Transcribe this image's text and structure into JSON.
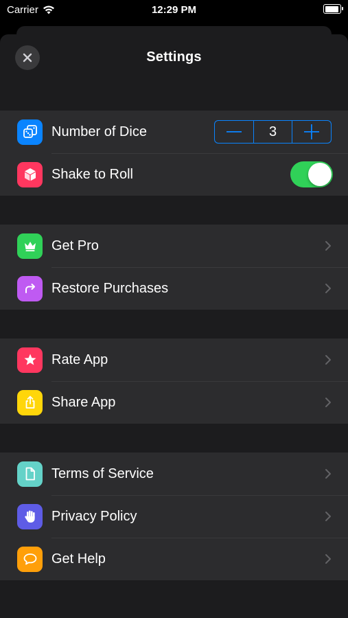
{
  "status_bar": {
    "carrier": "Carrier",
    "time": "12:29 PM"
  },
  "header": {
    "title": "Settings",
    "close_icon": "close-icon"
  },
  "colors": {
    "accent": "#0a84ff",
    "toggle_on": "#30d158",
    "sheet_bg": "#1c1c1e",
    "row_bg": "#2c2c2e"
  },
  "groups": [
    {
      "rows": [
        {
          "label": "Number of Dice",
          "icon": "dice-icon",
          "icon_color": "#0a84ff",
          "control": "stepper"
        },
        {
          "label": "Shake to Roll",
          "icon": "cube-icon",
          "icon_color": "#ff375f",
          "control": "toggle"
        }
      ]
    },
    {
      "rows": [
        {
          "label": "Get Pro",
          "icon": "crown-icon",
          "icon_color": "#30d158"
        },
        {
          "label": "Restore Purchases",
          "icon": "arrow-redo-icon",
          "icon_color": "#bf5af2"
        }
      ]
    },
    {
      "rows": [
        {
          "label": "Rate App",
          "icon": "star-icon",
          "icon_color": "#ff375f"
        },
        {
          "label": "Share App",
          "icon": "share-icon",
          "icon_color": "#ffd60a"
        }
      ]
    },
    {
      "rows": [
        {
          "label": "Terms of Service",
          "icon": "document-icon",
          "icon_color": "#64d2c8"
        },
        {
          "label": "Privacy Policy",
          "icon": "hand-icon",
          "icon_color": "#5e5ce6"
        },
        {
          "label": "Get Help",
          "icon": "chat-bubble-icon",
          "icon_color": "#ff9f0a"
        }
      ]
    }
  ],
  "stepper": {
    "value": "3",
    "decrement": "—",
    "increment": "+"
  },
  "toggle": {
    "state": "on"
  }
}
